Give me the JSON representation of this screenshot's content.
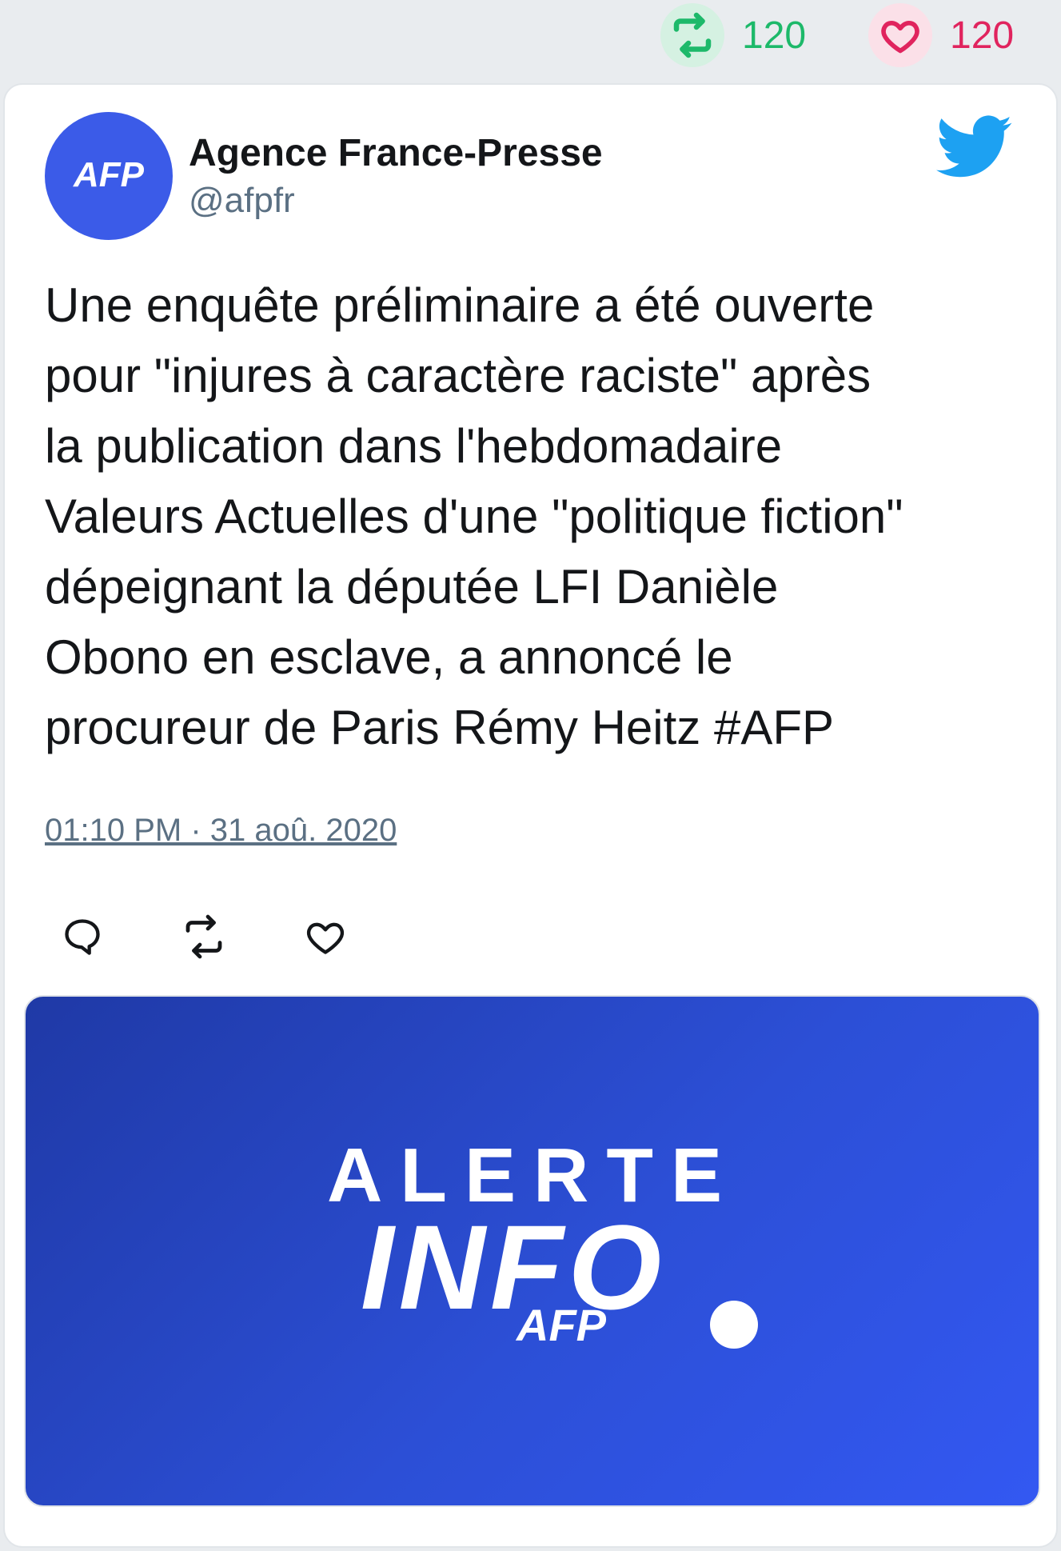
{
  "stats": {
    "retweet_count": "120",
    "like_count": "120"
  },
  "author": {
    "name": "Agence France-Presse",
    "handle": "@afpfr",
    "avatar_text": "AFP"
  },
  "tweet": {
    "lines": [
      "Une enquête préliminaire a été ouverte",
      "pour \"injures à caractère raciste\" après",
      "la publication dans l'hebdomadaire",
      "Valeurs Actuelles d'une \"politique fiction\"",
      "dépeignant la députée LFI Danièle",
      "Obono en esclave, a annoncé le",
      "procureur de Paris Rémy Heitz #AFP"
    ],
    "timestamp": "01:10 PM · 31 aoû. 2020"
  },
  "media": {
    "line1": "ALERTE",
    "line2": "INFO",
    "brand": "AFP"
  },
  "icons": {
    "retweet_stat": "retweet-icon",
    "like_stat": "heart-icon",
    "platform": "twitter-bird-icon",
    "reply": "reply-icon",
    "retweet": "retweet-icon",
    "like": "heart-icon"
  },
  "colors": {
    "retweet": "#1db96a",
    "like": "#e0245e",
    "twitter_blue": "#1da1f2",
    "afp_blue": "#3b5be8"
  }
}
